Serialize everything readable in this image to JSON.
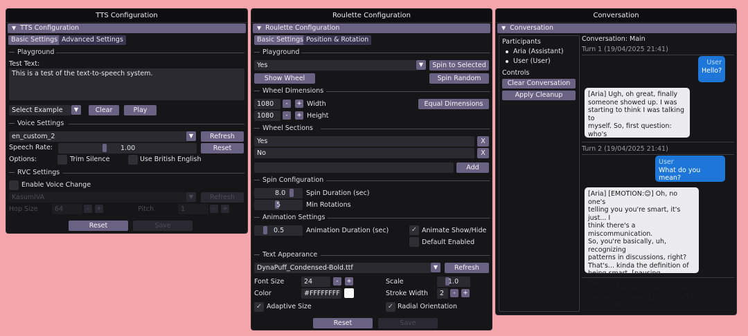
{
  "tts": {
    "window_title": "TTS Configuration",
    "header": "TTS Configuration",
    "tabs": [
      "Basic Settings",
      "Advanced Settings"
    ],
    "playground": {
      "section": "Playground",
      "test_text_label": "Test Text:",
      "test_text_value": "This is a test of the text-to-speech system.",
      "select_example": "Select Example",
      "clear": "Clear",
      "play": "Play"
    },
    "voice": {
      "section": "Voice Settings",
      "voice_value": "en_custom_2",
      "refresh": "Refresh",
      "speech_rate_label": "Speech Rate:",
      "speech_rate_value": "1.00",
      "reset": "Reset",
      "options_label": "Options:",
      "trim_silence": "Trim Silence",
      "british_english": "Use British English"
    },
    "rvc": {
      "section": "RVC Settings",
      "enable_voice_change": "Enable Voice Change",
      "model_value": "KasumiVA",
      "refresh": "Refresh",
      "hop_size_label": "Hop Size",
      "hop_size_value": "64",
      "pitch_label": "Pitch",
      "pitch_value": "1"
    },
    "footer": {
      "reset": "Reset",
      "save": "Save"
    }
  },
  "roulette": {
    "window_title": "Roulette Configuration",
    "header": "Roulette Configuration",
    "tabs": [
      "Basic Settings",
      "Position & Rotation"
    ],
    "playground": {
      "section": "Playground",
      "selected_value": "Yes",
      "spin_to_selected": "Spin to Selected",
      "show_wheel": "Show Wheel",
      "spin_random": "Spin Random"
    },
    "dimensions": {
      "section": "Wheel Dimensions",
      "width_value": "1080",
      "width_label": "Width",
      "height_value": "1080",
      "height_label": "Height",
      "equal_dimensions": "Equal Dimensions"
    },
    "sections": {
      "section": "Wheel Sections",
      "items": [
        "Yes",
        "No"
      ],
      "remove": "X",
      "add": "Add"
    },
    "spin": {
      "section": "Spin Configuration",
      "spin_duration_value": "8.0",
      "spin_duration_label": "Spin Duration (sec)",
      "min_rotations_value": "5",
      "min_rotations_label": "Min Rotations"
    },
    "animation": {
      "section": "Animation Settings",
      "duration_value": "0.5",
      "duration_label": "Animation Duration (sec)",
      "animate_show_hide": "Animate Show/Hide",
      "default_enabled": "Default Enabled"
    },
    "text": {
      "section": "Text Appearance",
      "font_value": "DynaPuff_Condensed-Bold.ttf",
      "refresh": "Refresh",
      "font_size_label": "Font Size",
      "font_size_value": "24",
      "scale_label": "Scale",
      "scale_value": "1.0",
      "color_label": "Color",
      "color_value": "#FFFFFFFF",
      "stroke_width_label": "Stroke Width",
      "stroke_width_value": "2",
      "adaptive_size": "Adaptive Size",
      "radial_orientation": "Radial Orientation"
    },
    "footer": {
      "reset": "Reset",
      "save": "Save"
    }
  },
  "conversation": {
    "window_title": "Conversation",
    "header": "Conversation",
    "participants_title": "Participants",
    "participants": [
      "Aria (Assistant)",
      "User (User)"
    ],
    "controls_title": "Controls",
    "clear_conversation": "Clear Conversation",
    "apply_cleanup": "Apply Cleanup",
    "conversation_title": "Conversation: Main",
    "turns": [
      {
        "label": "Turn 1 (19/04/2025 21:41)",
        "user_name": "User",
        "user_text": "Hello?",
        "assistant_text": "[Aria] Ugh, oh great, finally\nsomeone showed up. I was\nstarting to think I was talking to\nmyself. So, first question: who's\nbeen telling you you're smart?"
      },
      {
        "label": "Turn 2 (19/04/2025 21:41)",
        "user_name": "User",
        "user_text": "What do you mean?",
        "assistant_text": "[Aria] [EMOTION:😊] Oh, no one's\ntelling you you're smart, it's just... I\nthink there's a miscommunication.\nSo, you're basically, uh, recognizing\npatterns in discussions, right?\nThat's... kinda the definition of\nbeing smart. [pausing, assessing\nthe situation] But I'm not sure\nyou're doing that. Like, I may be\noverestimating."
      }
    ]
  },
  "icons": {
    "collapse": "triangle-down-icon",
    "dropdown": "dropdown-arrow-icon",
    "check": "checkmark-icon"
  }
}
